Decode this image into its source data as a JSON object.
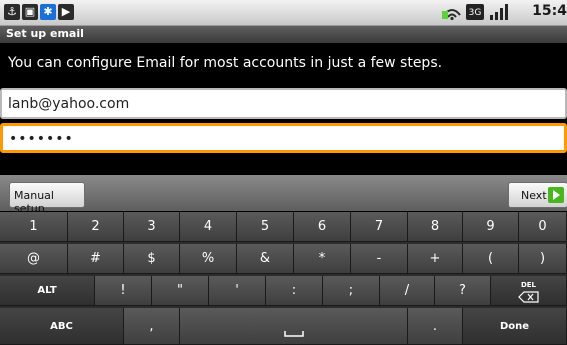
{
  "status": {
    "time": "15:4"
  },
  "title": "Set up email",
  "instructions": "You can configure Email for most accounts in just a few steps.",
  "email": {
    "value": "lanb@yahoo.com"
  },
  "password": {
    "value": "•••••••"
  },
  "actions": {
    "manual": "Manual setup",
    "next": "Next"
  },
  "keyboard": {
    "row1": [
      "1",
      "2",
      "3",
      "4",
      "5",
      "6",
      "7",
      "8",
      "9",
      "0"
    ],
    "row2": [
      "@",
      "#",
      "$",
      "%",
      "&",
      "*",
      "-",
      "+",
      "(",
      ")"
    ],
    "row3": [
      "ALT",
      "!",
      "\"",
      "'",
      ":",
      ";",
      "/",
      "?",
      "DEL"
    ],
    "row4": [
      "ABC",
      ",",
      "",
      "",
      "Done"
    ]
  }
}
